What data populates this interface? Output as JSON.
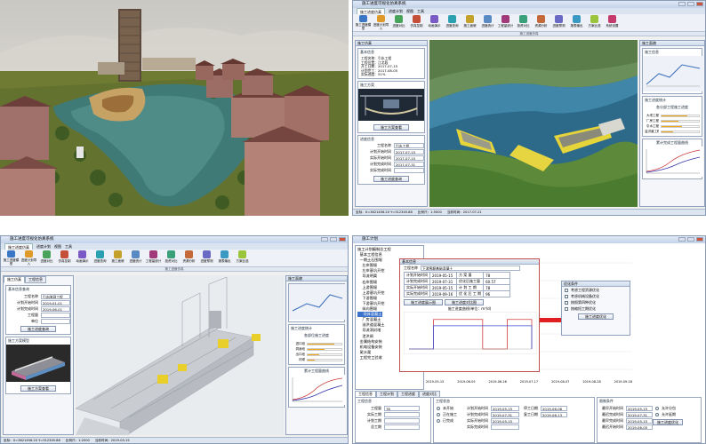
{
  "q2": {
    "title": "施工进度可视化仿真系统",
    "ribbon_tabs": [
      "施工进度仿真",
      "进度计划",
      "视图",
      "工具"
    ],
    "ribbon_buttons": [
      "施工进度模型",
      "进度计划导入",
      "进度对比",
      "仿真控制",
      "动画演示",
      "进度查询",
      "施工面貌",
      "进度统计",
      "工程量统计",
      "投资对比",
      "资源分析",
      "进度预测",
      "报表输出",
      "方案比选",
      "系统设置"
    ],
    "group_label": "施工进度仿真",
    "panel_title": "施工仿真",
    "info_box_title": "基本信息",
    "info_text": "工程名称：引水工程\n工程位置：江北段\n开工日期：2017-07-15\n计划完工：2017-08-05\n实际进度：51%",
    "model_box_title": "施工方案",
    "model_button": "施工方案查看",
    "progress_box_title": "进度信息",
    "fields": [
      {
        "label": "工程名称",
        "value": "引水工程"
      },
      {
        "label": "计划开始时间",
        "value": "2017-07-15"
      },
      {
        "label": "实际开始时间",
        "value": "2017-07-15"
      },
      {
        "label": "计划完成时间",
        "value": "2017-07-31"
      },
      {
        "label": "实际完成时间",
        "value": ""
      }
    ],
    "progress_button": "施工进度查询",
    "right_title": "施工面貌",
    "right_sub1": "施工信息",
    "right_sub2": "施工进度统计",
    "bar_title": "各分部工程施工进度",
    "bars": [
      {
        "label": "大坝工程",
        "pct": 0.7
      },
      {
        "label": "厂房工程",
        "pct": 0.45
      },
      {
        "label": "引水工程",
        "pct": 0.55
      },
      {
        "label": "溢洪道工程",
        "pct": 0.3
      }
    ],
    "curve_title": "累计完成工程量曲线",
    "status": [
      "坐标：X=3621456.20 Y=512345.88",
      "比例尺：1:5000",
      "当前时间：2017-07-21"
    ]
  },
  "q3": {
    "title": "施工进度可视化仿真系统",
    "ribbon_tabs": [
      "施工进度仿真",
      "进度计划",
      "视图",
      "工具"
    ],
    "ribbon_buttons": [
      "施工进度模型",
      "进度计划导入",
      "进度对比",
      "仿真控制",
      "动画演示",
      "进度查询",
      "施工面貌",
      "进度统计",
      "工程量统计",
      "投资对比",
      "资源分析",
      "进度预测",
      "报表输出",
      "方案比选"
    ],
    "group_label": "施工进度仿真",
    "panel_tabs": [
      "施工仿真",
      "工程信息"
    ],
    "basic_box_title": "基本信息查询",
    "fields": [
      {
        "label": "工程名称",
        "value": "引水隧洞工程"
      },
      {
        "label": "计划开始时间",
        "value": "2019-01-01"
      },
      {
        "label": "计划完成时间",
        "value": "2019-06-01"
      },
      {
        "label": "工程量",
        "value": ""
      },
      {
        "label": "单位",
        "value": ""
      }
    ],
    "query_button": "施工进度查询",
    "model_box_title": "施工方案模型",
    "model_button": "施工方案查看",
    "right_title": "施工面貌",
    "right_sub": "施工进度统计",
    "bar_title": "各部位施工进度",
    "bars": [
      {
        "label": "进口段",
        "pct": 0.8
      },
      {
        "label": "洞身段",
        "pct": 0.5
      },
      {
        "label": "出口段",
        "pct": 0.35
      },
      {
        "label": "衬砌",
        "pct": 0.2
      }
    ],
    "curve_title": "累计工程量曲线",
    "status": [
      "坐标：X=3621456.20 Y=512345.88",
      "比例尺：1:2000",
      "当前时间：2019-03-15"
    ]
  },
  "q4": {
    "title": "施工计划",
    "tree_title": "施工计划",
    "tree": [
      "施工计划编制总工程",
      "  基本工程信息",
      "  一期土石围堰",
      "    左岸围堰",
      "    左岸基坑开挖",
      "    导流明渠",
      "    右岸围堰",
      "    上游围堰",
      "    上游基坑开挖",
      "    下游围堰",
      "    下游基坑开挖",
      "    纵向围堰",
      "    坝体混凝土",
      "    厂房混凝土",
      "    溢洪道混凝土",
      "    导流洞封堵",
      "    泄洪闸",
      "  金属结构安装",
      "  机电设备安装",
      "  尾水渠",
      "  工程完工验收"
    ],
    "selected_index": 12,
    "tab_labels": [
      "工程信息",
      "工程计划",
      "工程进度",
      "进度对比"
    ],
    "float_title": "基本信息",
    "float_name_label": "工程名称",
    "float_name": "下游围堰基础混凝土",
    "float_rows": [
      [
        "计划开始时间",
        "2019-05-15",
        "方 案 量",
        "78"
      ],
      [
        "计划完成时间",
        "2019-07-31",
        "优化后施工量",
        "60.57"
      ],
      [
        "实际开始时间",
        "2019-05-15",
        "计 划 工 期",
        "78"
      ],
      [
        "实际完成时间",
        "2019-09-16",
        "优 化 后 工 期",
        "96"
      ]
    ],
    "float_buttons": [
      "施工进度展示图",
      "施工进度对比图"
    ],
    "chart_title": "施工进度曲线(单位：m³/d)",
    "right_box_title": "优化条件",
    "right_options": [
      "考虑工程资源优化",
      "考虑机械设备优化",
      "按照第四种优化",
      "按缩短工期优化"
    ],
    "right_button": "施工进度优化",
    "bottom_left_title": "工程信息",
    "bottom_left_rows": [
      [
        "工程量",
        "78"
      ],
      [
        "实际工期",
        ""
      ],
      [
        "计划工期",
        ""
      ],
      [
        "总工期",
        ""
      ]
    ],
    "bottom_mid_title": "工程状态",
    "bottom_mid_opts": [
      "未开始",
      "正在施工",
      "已完成"
    ],
    "bottom_mid_rows": [
      [
        "计划开始时间",
        "2019-05-15"
      ],
      [
        "计划完成时间",
        "2019-07-31"
      ],
      [
        "实际开始时间",
        "2019-05-15"
      ],
      [
        "实际完成时间",
        ""
      ]
    ],
    "bottom_mid_rows2": [
      [
        "停工日期",
        "2019-06-06"
      ],
      [
        "复工日期",
        "2019-06-13"
      ]
    ],
    "bottom_right_title": "限制条件",
    "bottom_right_rows": [
      [
        "最早开始时间",
        "2019-05-15"
      ],
      [
        "最迟完成时间",
        "2019-07-31"
      ],
      [
        "最早完成时间",
        "2019-05-15"
      ],
      [
        "最迟开始时间",
        "2019-06-05"
      ]
    ],
    "bottom_right_opts": [
      "允许分包",
      "允许延期"
    ],
    "bottom_right_button": "施工进度优化"
  },
  "chart_data": {
    "type": "line",
    "title": "施工进度曲线(单位：m³/d)",
    "x": [
      "2019-05-15",
      "2019-05-30",
      "2019-06-05",
      "2019-06-13",
      "2019-07-31",
      "2019-09-16"
    ],
    "series": [
      {
        "values": [
          0,
          70,
          70,
          0,
          70,
          0
        ]
      },
      {
        "values": [
          0,
          55,
          55,
          55,
          55,
          0
        ]
      }
    ],
    "ylim": [
      0,
      80
    ],
    "tick_labels": [
      "2019-05-15",
      "2019-06-05",
      "2019-06-26",
      "2019-07-17",
      "2019-08-07",
      "2019-08-28",
      "2019-09-18"
    ]
  }
}
